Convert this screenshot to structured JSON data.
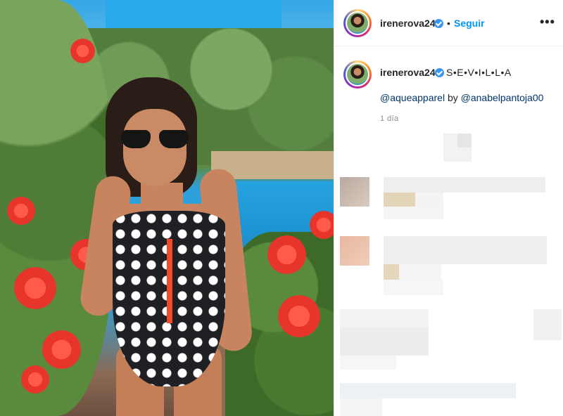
{
  "header": {
    "username": "irenerova24",
    "separator": "•",
    "follow_label": "Seguir",
    "more_label": "•••"
  },
  "caption": {
    "username": "irenerova24",
    "text": "S•E•V•I•L•L•A",
    "mention_1": "@aqueapparel",
    "by_word": " by ",
    "mention_2": "@anabelpantoja00",
    "timestamp": "1 día"
  },
  "colors": {
    "follow_blue": "#0095f6",
    "verified_blue": "#3897f0",
    "mention_navy": "#00376b",
    "timestamp_gray": "#8e8e8e"
  },
  "icons": {
    "verified": "verified-badge-icon",
    "more": "more-options-icon"
  }
}
